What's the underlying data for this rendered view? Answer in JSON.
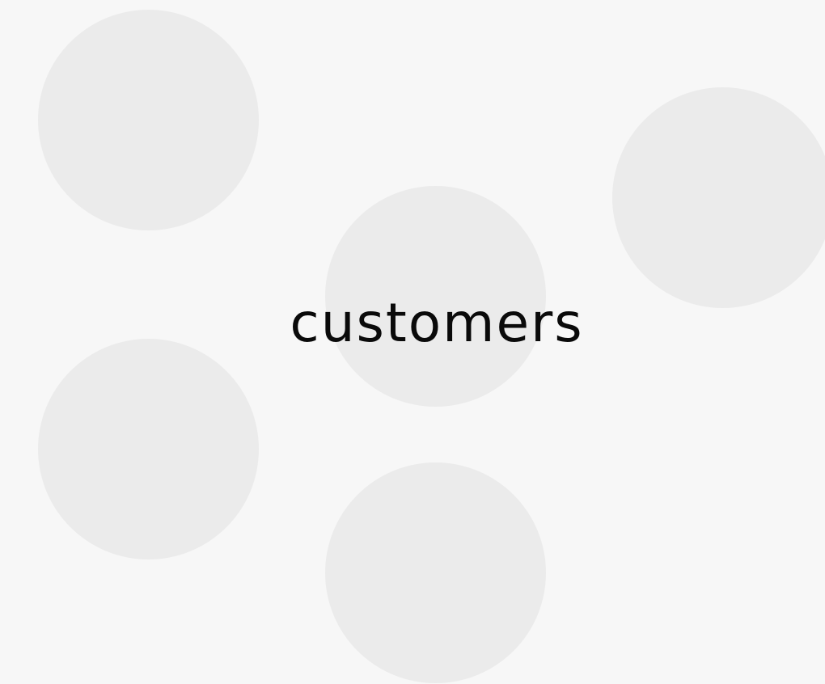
{
  "headline": "customers",
  "colors": {
    "background": "#f7f7f7",
    "circle": "#ebebeb",
    "text": "#0a0a0a"
  }
}
